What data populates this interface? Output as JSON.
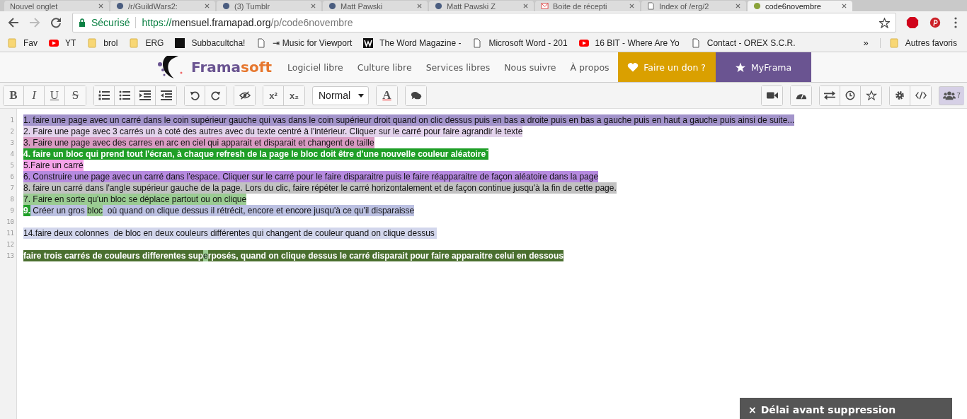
{
  "browser": {
    "tabs": [
      {
        "title": "Nouvel onglet",
        "kind": "blank",
        "selected": false
      },
      {
        "title": "/r/GuildWars2:",
        "kind": "site",
        "selected": false
      },
      {
        "title": "(3) Tumblr",
        "kind": "site",
        "selected": false
      },
      {
        "title": "Matt Pawski",
        "kind": "site",
        "selected": false
      },
      {
        "title": "Matt Pawski Z",
        "kind": "site",
        "selected": false
      },
      {
        "title": "Boite de récepti",
        "kind": "mail",
        "selected": false
      },
      {
        "title": "Index of /erg/2",
        "kind": "page",
        "selected": false
      },
      {
        "title": "code6novembre",
        "kind": "pad",
        "selected": true
      }
    ],
    "secure_label": "Sécurisé",
    "url": {
      "scheme": "https://",
      "host": "mensuel.framapad.org",
      "path": "/p/code6novembre"
    },
    "bookmarks": [
      {
        "label": "Fav",
        "kind": "folder"
      },
      {
        "label": "YT",
        "kind": "video"
      },
      {
        "label": "brol",
        "kind": "folder"
      },
      {
        "label": "ERG",
        "kind": "folder"
      },
      {
        "label": "Subbacultcha!",
        "kind": "square"
      },
      {
        "label": "⇥ Music for Viewport",
        "kind": "page"
      },
      {
        "label": "The Word Magazine -",
        "kind": "w"
      },
      {
        "label": "Microsoft Word - 201",
        "kind": "page"
      },
      {
        "label": "16 BIT - Where Are Yo",
        "kind": "video"
      },
      {
        "label": "Contact - OREX S.C.R.",
        "kind": "page"
      }
    ],
    "more": "»",
    "other_bookmarks": "Autres favoris"
  },
  "site_nav": {
    "logo_first": "Frama",
    "logo_second": "soft",
    "links": [
      "Logiciel libre",
      "Culture libre",
      "Services libres",
      "Nous suivre",
      "À propos"
    ],
    "donate": "Faire un don ?",
    "myframa": "MyFrama"
  },
  "toolbar": {
    "left_groups": [
      [
        {
          "kind": "bold",
          "label": "B"
        },
        {
          "kind": "italic",
          "label": "I"
        },
        {
          "kind": "underline",
          "label": "U"
        },
        {
          "kind": "strike",
          "label": "S"
        }
      ],
      [
        {
          "kind": "ordered-list"
        },
        {
          "kind": "bullet-list"
        },
        {
          "kind": "indent"
        },
        {
          "kind": "outdent"
        }
      ],
      [
        {
          "kind": "undo"
        },
        {
          "kind": "redo"
        }
      ],
      [
        {
          "kind": "hide-colors"
        }
      ],
      [
        {
          "kind": "sup",
          "label": "x²"
        },
        {
          "kind": "sub",
          "label": "x₂"
        }
      ]
    ],
    "style_select": "Normal",
    "after_select": [
      [
        {
          "kind": "text-color",
          "label": "A"
        }
      ],
      [
        {
          "kind": "comment"
        }
      ]
    ],
    "right_groups": [
      [
        {
          "kind": "video"
        }
      ],
      [
        {
          "kind": "gauge"
        }
      ],
      [
        {
          "kind": "import-export"
        },
        {
          "kind": "history"
        },
        {
          "kind": "star"
        }
      ],
      [
        {
          "kind": "settings"
        },
        {
          "kind": "embed"
        }
      ]
    ],
    "users_count": "7"
  },
  "editor": {
    "lines": [
      {
        "number": "1",
        "segments": [
          {
            "text": "1. faire une page avec un carré dans le coin supérieur gauche qui vas dans le coin supérieur droit quand on clic dessus puis en bas a droite puis en bas a gauche puis en haut a gauche puis ainsi de suite...",
            "color": "#a394cb"
          }
        ]
      },
      {
        "number": "2",
        "segments": [
          {
            "text": "2. Faire une page avec 3 carrés un à coté des autres avec du texte centré à l'intérieur. Cliquer sur le carré pour faire agrandir le texte",
            "color": "#e3d3ec"
          }
        ]
      },
      {
        "number": "3",
        "segments": [
          {
            "text": "3. Faire une page avec des carres en arc en ciel qui apparait et disparait et changent de taille",
            "color": "#d99bc2"
          }
        ]
      },
      {
        "number": "4",
        "segments": [
          {
            "text": "4. faire un bloc qui prend tout l'écran, à chaque refresh de la page le bloc doit être d'une nouvelle couleur aléatoire`",
            "color": "#1f9f27"
          }
        ]
      },
      {
        "number": "5",
        "segments": [
          {
            "text": "5.Faire un carré",
            "color": "#f5a3e9"
          }
        ]
      },
      {
        "number": "6",
        "segments": [
          {
            "text": "6. Construire une page avec un carré dans l'espace. Cliquer sur le carré pour le faire disparaitre puis le faire réapparaitre de façon aléatoire dans la page",
            "color": "#b68ae0"
          }
        ]
      },
      {
        "number": "7",
        "segments": [
          {
            "text": "8. faire un carré dans l'angle supérieur gauche de la page. Lors du clic, faire répéter le carré horizontalement et de façon continue jusqu'à la fin de cette page.",
            "color": "#c2c2c2"
          }
        ]
      },
      {
        "number": "8",
        "segments": [
          {
            "text": "7. Faire en sorte qu'un bloc se déplace partout ou on clique",
            "color": "#9acc92"
          }
        ]
      },
      {
        "number": "9",
        "segments": [
          {
            "text": "9.",
            "color": "#1f9f27"
          },
          {
            "text": " Créer un gros ",
            "color": "#bcc1e2"
          },
          {
            "text": "bloc",
            "color": "#9acc92"
          },
          {
            "text": "  où quand on clique dessus il rétrécit, encore et encore jusqu'à ce qu'il disparaisse",
            "color": "#bcc1e2"
          }
        ]
      },
      {
        "number": "10"
      },
      {
        "number": "11",
        "segments": [
          {
            "text": "14.faire deux colonnes  de bloc en deux couleurs différentes qui changent de couleur quand on clique dessus ",
            "color": "#d2d6ec"
          }
        ]
      },
      {
        "number": "12"
      },
      {
        "number": "13",
        "segments": [
          {
            "text": "faire trois carrés de couleurs differentes sup",
            "color": "#4a6f2f"
          },
          {
            "text": "e",
            "color": "#9acc92"
          },
          {
            "text": "rposés, quand on clique dessus le carré disparait pour faire apparaitre celui en dessous",
            "color": "#4a6f2f"
          }
        ]
      }
    ]
  },
  "notice": {
    "close": "×",
    "title": "Délai avant suppression"
  }
}
